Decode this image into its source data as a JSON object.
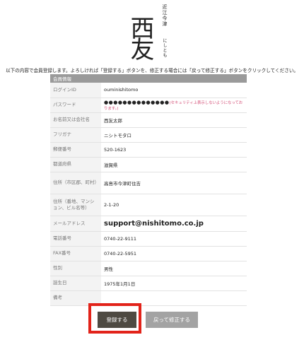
{
  "logo": {
    "top": "近江今津",
    "main": "西友",
    "sub": "にしとも"
  },
  "intro_text": "以下の内容で会員登録します。よろしければ「登録する」ボタンを、修正する場合には「戻って修正する」ボタンをクリックしてください。",
  "section_title": "会員情報",
  "rows": [
    {
      "label": "ログインID",
      "value": "ouminishitomo"
    },
    {
      "label": "パスワード",
      "value": "●●●●●●●●●●●●●●",
      "note": "(セキュリティ上表示しないようになっております。)"
    },
    {
      "label": "お名前又は会社名",
      "value": "西友太郎"
    },
    {
      "label": "フリガナ",
      "value": "ニシトモタロ"
    },
    {
      "label": "郵便番号",
      "value": "520-1623"
    },
    {
      "label": "都道府県",
      "value": "滋賀県"
    },
    {
      "label": "住所（市区郡、町村）",
      "value": "高島市今津町住吉"
    },
    {
      "label": "住所（番地、マンション、ビル名等）",
      "value": "2-1-20"
    },
    {
      "label": "メールアドレス",
      "value": "support@nishitomo.co.jp"
    },
    {
      "label": "電話番号",
      "value": "0740-22-9111"
    },
    {
      "label": "FAX番号",
      "value": "0740-22-5951"
    },
    {
      "label": "性別",
      "value": "男性"
    },
    {
      "label": "誕生日",
      "value": "1975年1月1日"
    },
    {
      "label": "備考",
      "value": ""
    }
  ],
  "buttons": {
    "register": "登録する",
    "back": "戻って修正する"
  },
  "colors": {
    "header_bg": "#9a9a9a",
    "primary_button": "#4e4a42",
    "secondary_button": "#a3a3a3",
    "highlight": "#e2231a",
    "note": "#d34b74"
  }
}
